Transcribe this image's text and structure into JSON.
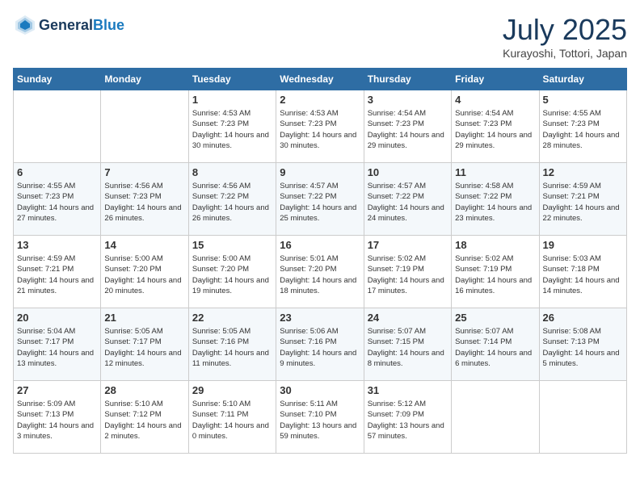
{
  "app": {
    "name_general": "General",
    "name_blue": "Blue"
  },
  "calendar": {
    "month": "July 2025",
    "location": "Kurayoshi, Tottori, Japan",
    "days_of_week": [
      "Sunday",
      "Monday",
      "Tuesday",
      "Wednesday",
      "Thursday",
      "Friday",
      "Saturday"
    ],
    "weeks": [
      [
        {
          "day": "",
          "info": ""
        },
        {
          "day": "",
          "info": ""
        },
        {
          "day": "1",
          "info": "Sunrise: 4:53 AM\nSunset: 7:23 PM\nDaylight: 14 hours and 30 minutes."
        },
        {
          "day": "2",
          "info": "Sunrise: 4:53 AM\nSunset: 7:23 PM\nDaylight: 14 hours and 30 minutes."
        },
        {
          "day": "3",
          "info": "Sunrise: 4:54 AM\nSunset: 7:23 PM\nDaylight: 14 hours and 29 minutes."
        },
        {
          "day": "4",
          "info": "Sunrise: 4:54 AM\nSunset: 7:23 PM\nDaylight: 14 hours and 29 minutes."
        },
        {
          "day": "5",
          "info": "Sunrise: 4:55 AM\nSunset: 7:23 PM\nDaylight: 14 hours and 28 minutes."
        }
      ],
      [
        {
          "day": "6",
          "info": "Sunrise: 4:55 AM\nSunset: 7:23 PM\nDaylight: 14 hours and 27 minutes."
        },
        {
          "day": "7",
          "info": "Sunrise: 4:56 AM\nSunset: 7:23 PM\nDaylight: 14 hours and 26 minutes."
        },
        {
          "day": "8",
          "info": "Sunrise: 4:56 AM\nSunset: 7:22 PM\nDaylight: 14 hours and 26 minutes."
        },
        {
          "day": "9",
          "info": "Sunrise: 4:57 AM\nSunset: 7:22 PM\nDaylight: 14 hours and 25 minutes."
        },
        {
          "day": "10",
          "info": "Sunrise: 4:57 AM\nSunset: 7:22 PM\nDaylight: 14 hours and 24 minutes."
        },
        {
          "day": "11",
          "info": "Sunrise: 4:58 AM\nSunset: 7:22 PM\nDaylight: 14 hours and 23 minutes."
        },
        {
          "day": "12",
          "info": "Sunrise: 4:59 AM\nSunset: 7:21 PM\nDaylight: 14 hours and 22 minutes."
        }
      ],
      [
        {
          "day": "13",
          "info": "Sunrise: 4:59 AM\nSunset: 7:21 PM\nDaylight: 14 hours and 21 minutes."
        },
        {
          "day": "14",
          "info": "Sunrise: 5:00 AM\nSunset: 7:20 PM\nDaylight: 14 hours and 20 minutes."
        },
        {
          "day": "15",
          "info": "Sunrise: 5:00 AM\nSunset: 7:20 PM\nDaylight: 14 hours and 19 minutes."
        },
        {
          "day": "16",
          "info": "Sunrise: 5:01 AM\nSunset: 7:20 PM\nDaylight: 14 hours and 18 minutes."
        },
        {
          "day": "17",
          "info": "Sunrise: 5:02 AM\nSunset: 7:19 PM\nDaylight: 14 hours and 17 minutes."
        },
        {
          "day": "18",
          "info": "Sunrise: 5:02 AM\nSunset: 7:19 PM\nDaylight: 14 hours and 16 minutes."
        },
        {
          "day": "19",
          "info": "Sunrise: 5:03 AM\nSunset: 7:18 PM\nDaylight: 14 hours and 14 minutes."
        }
      ],
      [
        {
          "day": "20",
          "info": "Sunrise: 5:04 AM\nSunset: 7:17 PM\nDaylight: 14 hours and 13 minutes."
        },
        {
          "day": "21",
          "info": "Sunrise: 5:05 AM\nSunset: 7:17 PM\nDaylight: 14 hours and 12 minutes."
        },
        {
          "day": "22",
          "info": "Sunrise: 5:05 AM\nSunset: 7:16 PM\nDaylight: 14 hours and 11 minutes."
        },
        {
          "day": "23",
          "info": "Sunrise: 5:06 AM\nSunset: 7:16 PM\nDaylight: 14 hours and 9 minutes."
        },
        {
          "day": "24",
          "info": "Sunrise: 5:07 AM\nSunset: 7:15 PM\nDaylight: 14 hours and 8 minutes."
        },
        {
          "day": "25",
          "info": "Sunrise: 5:07 AM\nSunset: 7:14 PM\nDaylight: 14 hours and 6 minutes."
        },
        {
          "day": "26",
          "info": "Sunrise: 5:08 AM\nSunset: 7:13 PM\nDaylight: 14 hours and 5 minutes."
        }
      ],
      [
        {
          "day": "27",
          "info": "Sunrise: 5:09 AM\nSunset: 7:13 PM\nDaylight: 14 hours and 3 minutes."
        },
        {
          "day": "28",
          "info": "Sunrise: 5:10 AM\nSunset: 7:12 PM\nDaylight: 14 hours and 2 minutes."
        },
        {
          "day": "29",
          "info": "Sunrise: 5:10 AM\nSunset: 7:11 PM\nDaylight: 14 hours and 0 minutes."
        },
        {
          "day": "30",
          "info": "Sunrise: 5:11 AM\nSunset: 7:10 PM\nDaylight: 13 hours and 59 minutes."
        },
        {
          "day": "31",
          "info": "Sunrise: 5:12 AM\nSunset: 7:09 PM\nDaylight: 13 hours and 57 minutes."
        },
        {
          "day": "",
          "info": ""
        },
        {
          "day": "",
          "info": ""
        }
      ]
    ]
  }
}
